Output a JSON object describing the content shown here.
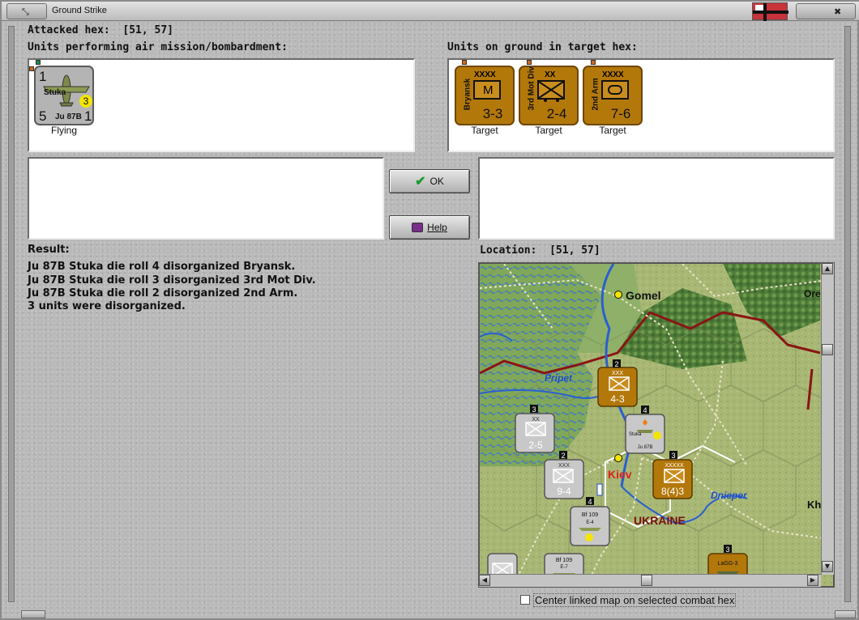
{
  "window": {
    "title": "Ground Strike"
  },
  "header": {
    "attacked_hex_label": "Attacked hex:  [51, 57]"
  },
  "air_units": {
    "heading": "Units performing air mission/bombardment:",
    "units": [
      {
        "name": "Stuka",
        "type": "Ju 87B",
        "left_top": "1",
        "bottom_left": "5",
        "bottom_right": "1",
        "range_badge": "3",
        "status": "Flying"
      }
    ]
  },
  "ground_units": {
    "heading": "Units on ground in target hex:",
    "units": [
      {
        "name": "Bryansk",
        "size": "XXXX",
        "symbol_letter": "M",
        "strength": "3-3",
        "status": "Target"
      },
      {
        "name": "3rd Mot Div",
        "size": "XX",
        "symbol_letter": "",
        "strength": "2-4",
        "status": "Target"
      },
      {
        "name": "2nd Arm",
        "size": "XXXX",
        "symbol_letter": "",
        "strength": "7-6",
        "status": "Target"
      }
    ]
  },
  "buttons": {
    "ok_label": "OK",
    "help_label": "Help"
  },
  "result": {
    "heading": "Result:",
    "lines": [
      "Ju 87B Stuka die roll 4 disorganized Bryansk.",
      "Ju 87B Stuka die roll 3 disorganized 3rd Mot Div.",
      "Ju 87B Stuka die roll 2 disorganized 2nd Arm.",
      "3 units were disorganized."
    ]
  },
  "location": {
    "label": "Location:  [51, 57]",
    "map_labels": {
      "gomel": "Gomel",
      "pripet": "Pripet",
      "kiev": "Kiev",
      "dnieper": "Dnieper",
      "ukraine": "UKRAINE",
      "ore": "Ore",
      "kh": "Kh"
    },
    "map_units": [
      {
        "label": "4-3",
        "size": "XXX",
        "stack": "2"
      },
      {
        "label": "2-5",
        "size": "XX",
        "stack": "3"
      },
      {
        "label": "9-4",
        "size": "XXX",
        "stack": "2"
      },
      {
        "label": "8(4)3",
        "size": "XXXXX",
        "stack": "3"
      },
      {
        "label": "Stuka",
        "type": "Ju 87B",
        "stack": "4"
      },
      {
        "label": "Bf 109",
        "type": "E-4",
        "stack": "4"
      },
      {
        "label": "Bf 109",
        "type": "E-7",
        "stack": ""
      },
      {
        "label": "LaGG-3",
        "stack": "3"
      }
    ]
  },
  "footer": {
    "center_checkbox_label": "Center linked map on selected combat hex",
    "center_checked": false
  },
  "colors": {
    "soviet_unit": "#b3780a",
    "axis_unit": "#b4b4b4",
    "border_red": "#8b1414",
    "river_blue": "#2a5fd0"
  }
}
